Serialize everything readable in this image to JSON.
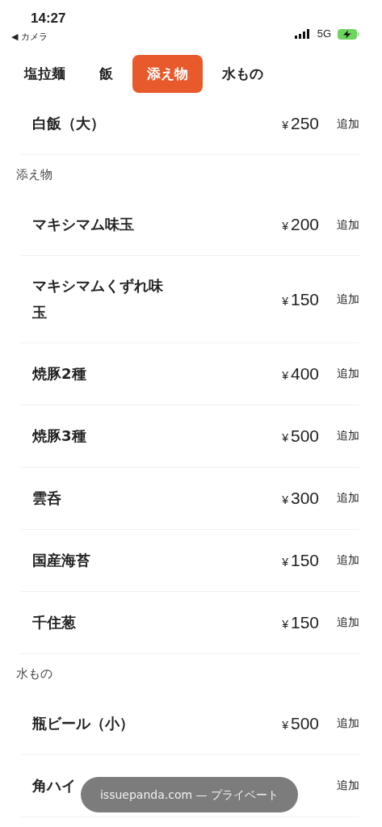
{
  "status_bar": {
    "time": "14:27",
    "back_label": "◀ カメラ",
    "network": "5G"
  },
  "tabs": [
    {
      "label": "塩拉麺",
      "selected": false
    },
    {
      "label": "飯",
      "selected": false
    },
    {
      "label": "添え物",
      "selected": true
    },
    {
      "label": "水もの",
      "selected": false
    }
  ],
  "list": [
    {
      "kind": "item",
      "name": "白飯（大）",
      "price": "¥250",
      "action": "追加"
    },
    {
      "kind": "header",
      "label": "添え物"
    },
    {
      "kind": "item",
      "name": "マキシマム味玉",
      "price": "¥200",
      "action": "追加"
    },
    {
      "kind": "item",
      "name": "マキシマムくずれ味玉",
      "price": "¥150",
      "action": "追加"
    },
    {
      "kind": "item",
      "name": "焼豚2種",
      "price": "¥400",
      "action": "追加"
    },
    {
      "kind": "item",
      "name": "焼豚3種",
      "price": "¥500",
      "action": "追加"
    },
    {
      "kind": "item",
      "name": "雲呑",
      "price": "¥300",
      "action": "追加"
    },
    {
      "kind": "item",
      "name": "国産海苔",
      "price": "¥150",
      "action": "追加"
    },
    {
      "kind": "item",
      "name": "千住葱",
      "price": "¥150",
      "action": "追加"
    },
    {
      "kind": "header",
      "label": "水もの"
    },
    {
      "kind": "item",
      "name": "瓶ビール（小）",
      "price": "¥500",
      "action": "追加"
    },
    {
      "kind": "item",
      "name": "角ハイ",
      "action": "追加"
    }
  ],
  "url_pill": "issuepanda.com — プライベート"
}
